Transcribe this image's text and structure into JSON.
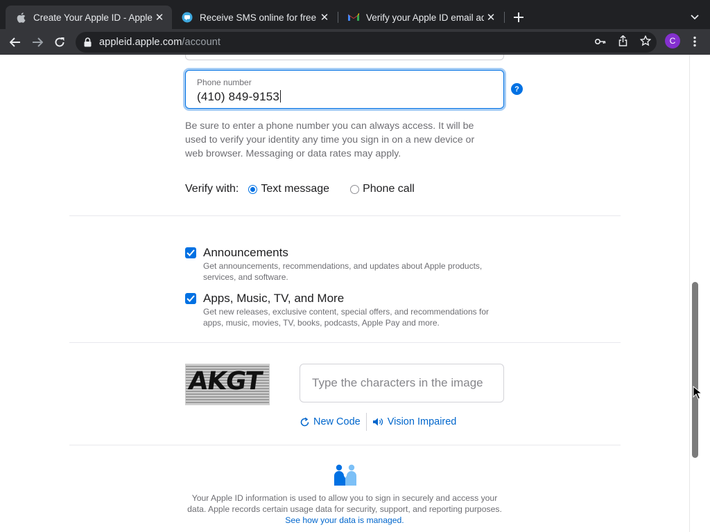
{
  "browser": {
    "tabs": [
      {
        "title": "Create Your Apple ID - Apple",
        "icon": "apple-icon",
        "active": true
      },
      {
        "title": "Receive SMS online for free | T",
        "icon": "sms-site-icon",
        "active": false
      },
      {
        "title": "Verify your Apple ID email addr",
        "icon": "gmail-icon",
        "active": false
      }
    ],
    "url_host": "appleid.apple.com",
    "url_path": "/account",
    "profile_initial": "C"
  },
  "form": {
    "phone_label": "Phone number",
    "phone_value": "(410) 849-9153",
    "help_symbol": "?",
    "phone_hint": "Be sure to enter a phone number you can always access. It will be used to verify your identity any time you sign in on a new device or web browser. Messaging or data rates may apply.",
    "verify_label": "Verify with:",
    "verify_options": [
      {
        "label": "Text message",
        "selected": true
      },
      {
        "label": "Phone call",
        "selected": false
      }
    ]
  },
  "subscriptions": [
    {
      "title": "Announcements",
      "checked": true,
      "description": "Get announcements, recommendations, and updates about Apple products, services, and software."
    },
    {
      "title": "Apps, Music, TV, and More",
      "checked": true,
      "description": "Get new releases, exclusive content, special offers, and recommendations for apps, music, movies, TV, books, podcasts, Apple Pay and more."
    }
  ],
  "captcha": {
    "image_text": "AKGT",
    "input_placeholder": "Type the characters in the image",
    "new_code_label": "New Code",
    "vision_impaired_label": "Vision Impaired"
  },
  "privacy": {
    "text": "Your Apple ID information is used to allow you to sign in securely and access your data. Apple records certain usage data for security, support, and reporting purposes.",
    "link_text": "See how your data is managed."
  },
  "colors": {
    "accent": "#0071e3",
    "link": "#0066cc",
    "chrome_dark": "#202124",
    "chrome_toolbar": "#35363a",
    "profile": "#8430ce"
  }
}
